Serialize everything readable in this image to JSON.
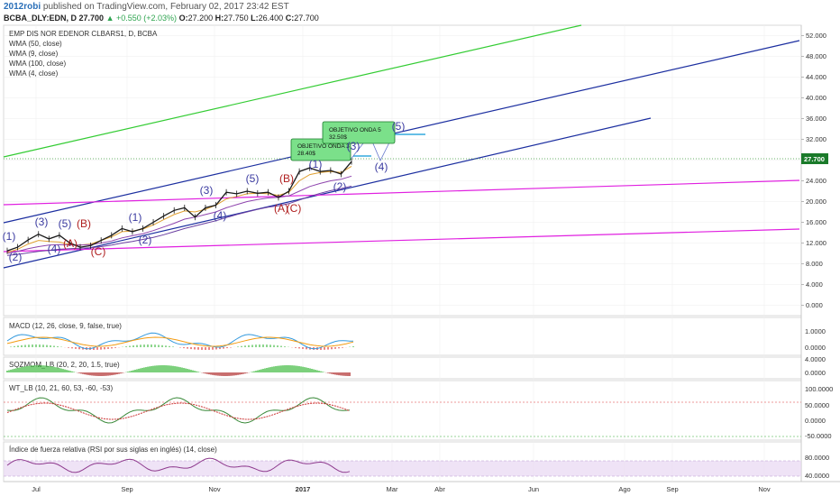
{
  "header": {
    "author": "2012robi",
    "published": "published on TradingView.com, February 02, 2017 23:42 EST",
    "symbol": "BCBA_DLY:EDN, D",
    "last": "27.700",
    "change": "▲ +0.550 (+2.03%)",
    "o_label": "O:",
    "o_val": "27.200",
    "h_label": "H:",
    "h_val": "27.750",
    "l_label": "L:",
    "l_val": "26.400",
    "c_label": "C:",
    "c_val": "27.700"
  },
  "legend": {
    "title": "EMP DIS NOR EDENOR CLBARS1, D, BCBA",
    "lines": [
      "WMA (50, close)",
      "WMA (9, close)",
      "WMA (100, close)",
      "WMA (4, close)"
    ]
  },
  "price_marker": "27.700",
  "colors": {
    "price_line": "#1a1a1a",
    "wma_fast": "#f39c12",
    "wma_slow": "#8e44ad",
    "channel_blue": "#1c2fa0",
    "channel_green": "#33cc33",
    "channel_magenta": "#e020e0",
    "wave_blue": "#3a3aa0",
    "wave_red": "#b02020",
    "target_box": "#7be08a",
    "macd_line": "#3399dd",
    "signal_line": "#f39c12",
    "hist_pos": "#44bb44",
    "hist_neg": "#dd3333",
    "rsi_line": "#8e3a8e",
    "rsi_band": "#e8d7f2"
  },
  "targets": [
    {
      "title": "OBJETIVO ONDA 3",
      "value": "28.40$"
    },
    {
      "title": "OBJETIVO ONDA 5",
      "value": "32.50$"
    }
  ],
  "waves": [
    {
      "label": "(1)",
      "color": "blue"
    },
    {
      "label": "(2)",
      "color": "blue"
    },
    {
      "label": "(3)",
      "color": "blue"
    },
    {
      "label": "(4)",
      "color": "blue"
    },
    {
      "label": "(5)",
      "color": "blue"
    },
    {
      "label": "(A)",
      "color": "red"
    },
    {
      "label": "(B)",
      "color": "red"
    },
    {
      "label": "(C)",
      "color": "red"
    },
    {
      "label": "(1)",
      "color": "blue"
    },
    {
      "label": "(2)",
      "color": "blue"
    },
    {
      "label": "(3)",
      "color": "blue"
    },
    {
      "label": "(4)",
      "color": "blue"
    },
    {
      "label": "(5)",
      "color": "blue"
    },
    {
      "label": "(B)",
      "color": "red"
    },
    {
      "label": "(A)",
      "color": "red"
    },
    {
      "label": "(C)",
      "color": "red"
    },
    {
      "label": "(1)",
      "color": "blue"
    },
    {
      "label": "(2)",
      "color": "blue"
    },
    {
      "label": "(3)",
      "color": "blue"
    },
    {
      "label": "(4)",
      "color": "blue"
    },
    {
      "label": "(5)",
      "color": "blue"
    }
  ],
  "panels": {
    "macd": {
      "title": "MACD (12, 26, close, 9, false, true)",
      "ticks": [
        "1.0000",
        "0.0000"
      ]
    },
    "sqz": {
      "title": "SQZMOM_LB (20, 2, 20, 1.5, true)",
      "ticks": [
        "4.0000",
        "0.0000"
      ]
    },
    "wt": {
      "title": "WT_LB (10, 21, 60, 53, -60, -53)",
      "ticks": [
        "100.0000",
        "50.0000",
        "0.0000",
        "-50.0000"
      ]
    },
    "rsi": {
      "title": "Índice de fuerza relativa (RSI por sus siglas en inglés) (14, close)",
      "ticks": [
        "80.0000",
        "40.0000"
      ]
    }
  },
  "x_axis": {
    "labels": [
      "Jul",
      "Sep",
      "Nov",
      "2017",
      "Mar",
      "Abr",
      "Jun",
      "Ago",
      "Sep",
      "Nov"
    ]
  },
  "chart_data": {
    "type": "line",
    "title": "EMP DIS NOR EDENOR CLBARS1, D, BCBA",
    "y_ticks": [
      52,
      48,
      44,
      40,
      36,
      32,
      28,
      24,
      20,
      16,
      12,
      8,
      4,
      0
    ],
    "y_tick_labels": [
      "52.000",
      "48.000",
      "44.000",
      "40.000",
      "36.000",
      "32.000",
      "28.000",
      "24.000",
      "20.000",
      "16.000",
      "12.000",
      "8.000",
      "4.000",
      "0.000"
    ],
    "ylim": [
      -2,
      54
    ],
    "x_tick_labels": [
      "Jul",
      "Sep",
      "Nov",
      "2017",
      "Mar",
      "Abr",
      "Jun",
      "Ago",
      "Sep",
      "Nov"
    ],
    "series": [
      {
        "values": [
          10.5,
          11.2,
          12.6,
          13.7,
          12.8,
          13.5,
          12.0,
          11.2,
          11.5,
          12.5,
          13.5,
          14.8,
          14.2,
          14.8,
          16.0,
          17.2,
          18.3,
          18.8,
          17.0,
          18.8,
          19.3,
          21.8,
          21.5,
          22.0,
          21.6,
          21.8,
          20.8,
          22.0,
          25.8,
          26.5,
          25.8,
          26.0,
          25.3,
          27.7
        ]
      },
      {
        "values": [
          10.2,
          10.8,
          11.8,
          12.5,
          12.3,
          12.2,
          11.7,
          11.6,
          11.8,
          12.5,
          13.2,
          14.2,
          14.3,
          14.7,
          15.5,
          16.5,
          17.5,
          18.2,
          18.0,
          18.5,
          19.3,
          20.5,
          21.0,
          21.5,
          21.6,
          21.5,
          21.2,
          21.8,
          24.0,
          25.2,
          25.6,
          25.8,
          25.6,
          26.8
        ]
      },
      {
        "values": [
          10.0,
          10.4,
          10.9,
          11.3,
          11.6,
          11.7,
          11.6,
          11.6,
          11.7,
          12.0,
          12.4,
          13.0,
          13.4,
          13.8,
          14.4,
          15.1,
          15.8,
          16.6,
          17.0,
          17.5,
          18.0,
          18.8,
          19.4,
          20.0,
          20.4,
          20.7,
          20.8,
          21.1,
          22.0,
          22.9,
          23.5,
          24.0,
          24.3,
          24.9
        ]
      },
      {
        "values": [
          9.6,
          9.8,
          10.1,
          10.4,
          10.6,
          10.8,
          10.9,
          11.0,
          11.1,
          11.3,
          11.6,
          12.0,
          12.3,
          12.7,
          13.1,
          13.6,
          14.2,
          14.8,
          15.3,
          15.8,
          16.3,
          16.9,
          17.5,
          18.0,
          18.5,
          18.9,
          19.2,
          19.6,
          20.3,
          21.0,
          21.6,
          22.1,
          22.5,
          23.0
        ]
      }
    ]
  }
}
